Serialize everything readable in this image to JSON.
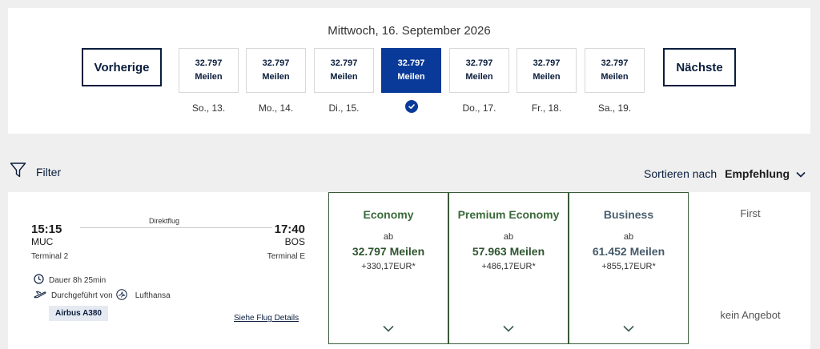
{
  "date_bar": {
    "title": "Mittwoch, 16. September 2026",
    "prev_label": "Vorherige",
    "next_label": "Nächste",
    "days": [
      {
        "miles": "32.797",
        "unit": "Meilen",
        "label": "So., 13."
      },
      {
        "miles": "32.797",
        "unit": "Meilen",
        "label": "Mo., 14."
      },
      {
        "miles": "32.797",
        "unit": "Meilen",
        "label": "Di., 15."
      },
      {
        "miles": "32.797",
        "unit": "Meilen",
        "label": ""
      },
      {
        "miles": "32.797",
        "unit": "Meilen",
        "label": "Do., 17."
      },
      {
        "miles": "32.797",
        "unit": "Meilen",
        "label": "Fr., 18."
      },
      {
        "miles": "32.797",
        "unit": "Meilen",
        "label": "Sa., 19."
      }
    ],
    "selected_index": 3
  },
  "toolbar": {
    "filter_label": "Filter",
    "sort_label": "Sortieren nach",
    "sort_value": "Empfehlung"
  },
  "flight": {
    "type": "Direktflug",
    "dep_time": "15:15",
    "arr_time": "17:40",
    "dep_code": "MUC",
    "arr_code": "BOS",
    "dep_terminal": "Terminal 2",
    "arr_terminal": "Terminal E",
    "duration": "Dauer 8h 25min",
    "operated_by": "Durchgeführt von",
    "airline": "Lufthansa",
    "aircraft": "Airbus A380",
    "details_link": "Siehe Flug Details"
  },
  "fares": [
    {
      "name": "Economy",
      "from": "ab",
      "miles": "32.797 Meilen",
      "eur": "+330,17EUR*"
    },
    {
      "name": "Premium Economy",
      "from": "ab",
      "miles": "57.963 Meilen",
      "eur": "+486,17EUR*"
    },
    {
      "name": "Business",
      "from": "ab",
      "miles": "61.452 Meilen",
      "eur": "+855,17EUR*"
    }
  ],
  "first": {
    "name": "First",
    "no_offer": "kein Angebot"
  },
  "colors": {
    "navy": "#0a1d3d",
    "selected": "#0a3a99",
    "fare_border": "#3a5a3a",
    "fare_green": "#3a6a3a"
  }
}
